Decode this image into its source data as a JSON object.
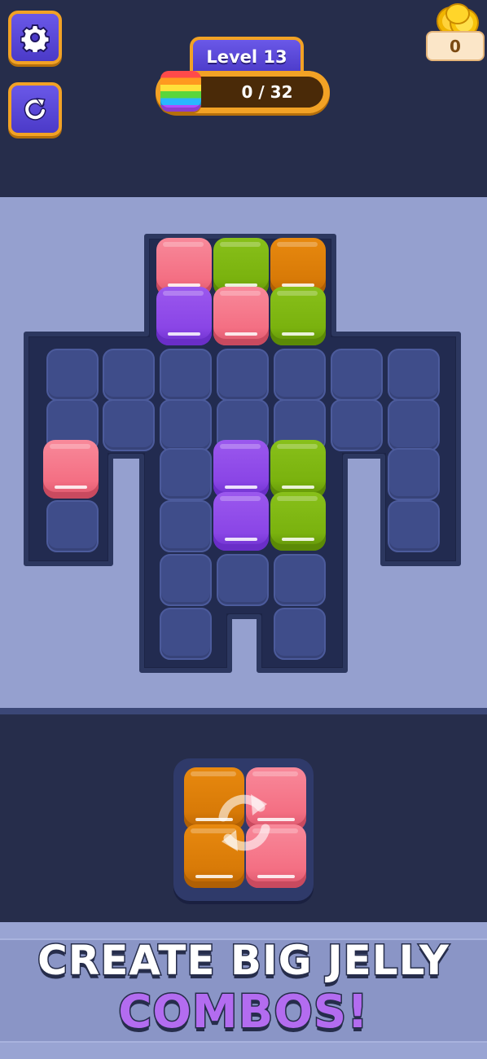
{
  "hud": {
    "settings_icon": "gear-icon",
    "restart_icon": "restart-icon",
    "level_label": "Level 13",
    "progress": {
      "current": 0,
      "total": 32,
      "text": "0 / 32"
    },
    "progress_icon": "rainbow-jelly-icon",
    "coins": {
      "value": "0",
      "icon": "gold-coins-icon"
    }
  },
  "board": {
    "colors": {
      "pink": "#f46f83",
      "green": "#7ab20e",
      "orange": "#d87a07",
      "purple": "#8a45e6",
      "empty_cell": "#3f4d8a",
      "board_bg": "#222b4f"
    },
    "rows": [
      [
        "-",
        "-",
        "pink",
        "green",
        "orange",
        "-",
        "-"
      ],
      [
        "-",
        "-",
        "purple",
        "pink",
        "green",
        "-",
        "-"
      ],
      [
        "empty",
        "empty",
        "empty",
        "empty",
        "empty",
        "empty",
        "empty"
      ],
      [
        "empty",
        "empty",
        "empty",
        "empty",
        "empty",
        "empty",
        "empty"
      ],
      [
        "pink",
        "-",
        "empty",
        "purple",
        "green",
        "-",
        "empty"
      ],
      [
        "empty",
        "-",
        "empty",
        "purple",
        "green",
        "-",
        "empty"
      ],
      [
        "-",
        "-",
        "empty",
        "empty",
        "empty",
        "-",
        "-"
      ],
      [
        "-",
        "-",
        "empty",
        "-",
        "empty",
        "-",
        "-"
      ]
    ]
  },
  "tray": {
    "piece": [
      [
        "orange",
        "pink"
      ],
      [
        "orange",
        "pink"
      ]
    ],
    "rotate_icon": "rotate-icon"
  },
  "banner": {
    "line1": "CREATE BIG JELLY",
    "line2": "COMBOS!"
  }
}
